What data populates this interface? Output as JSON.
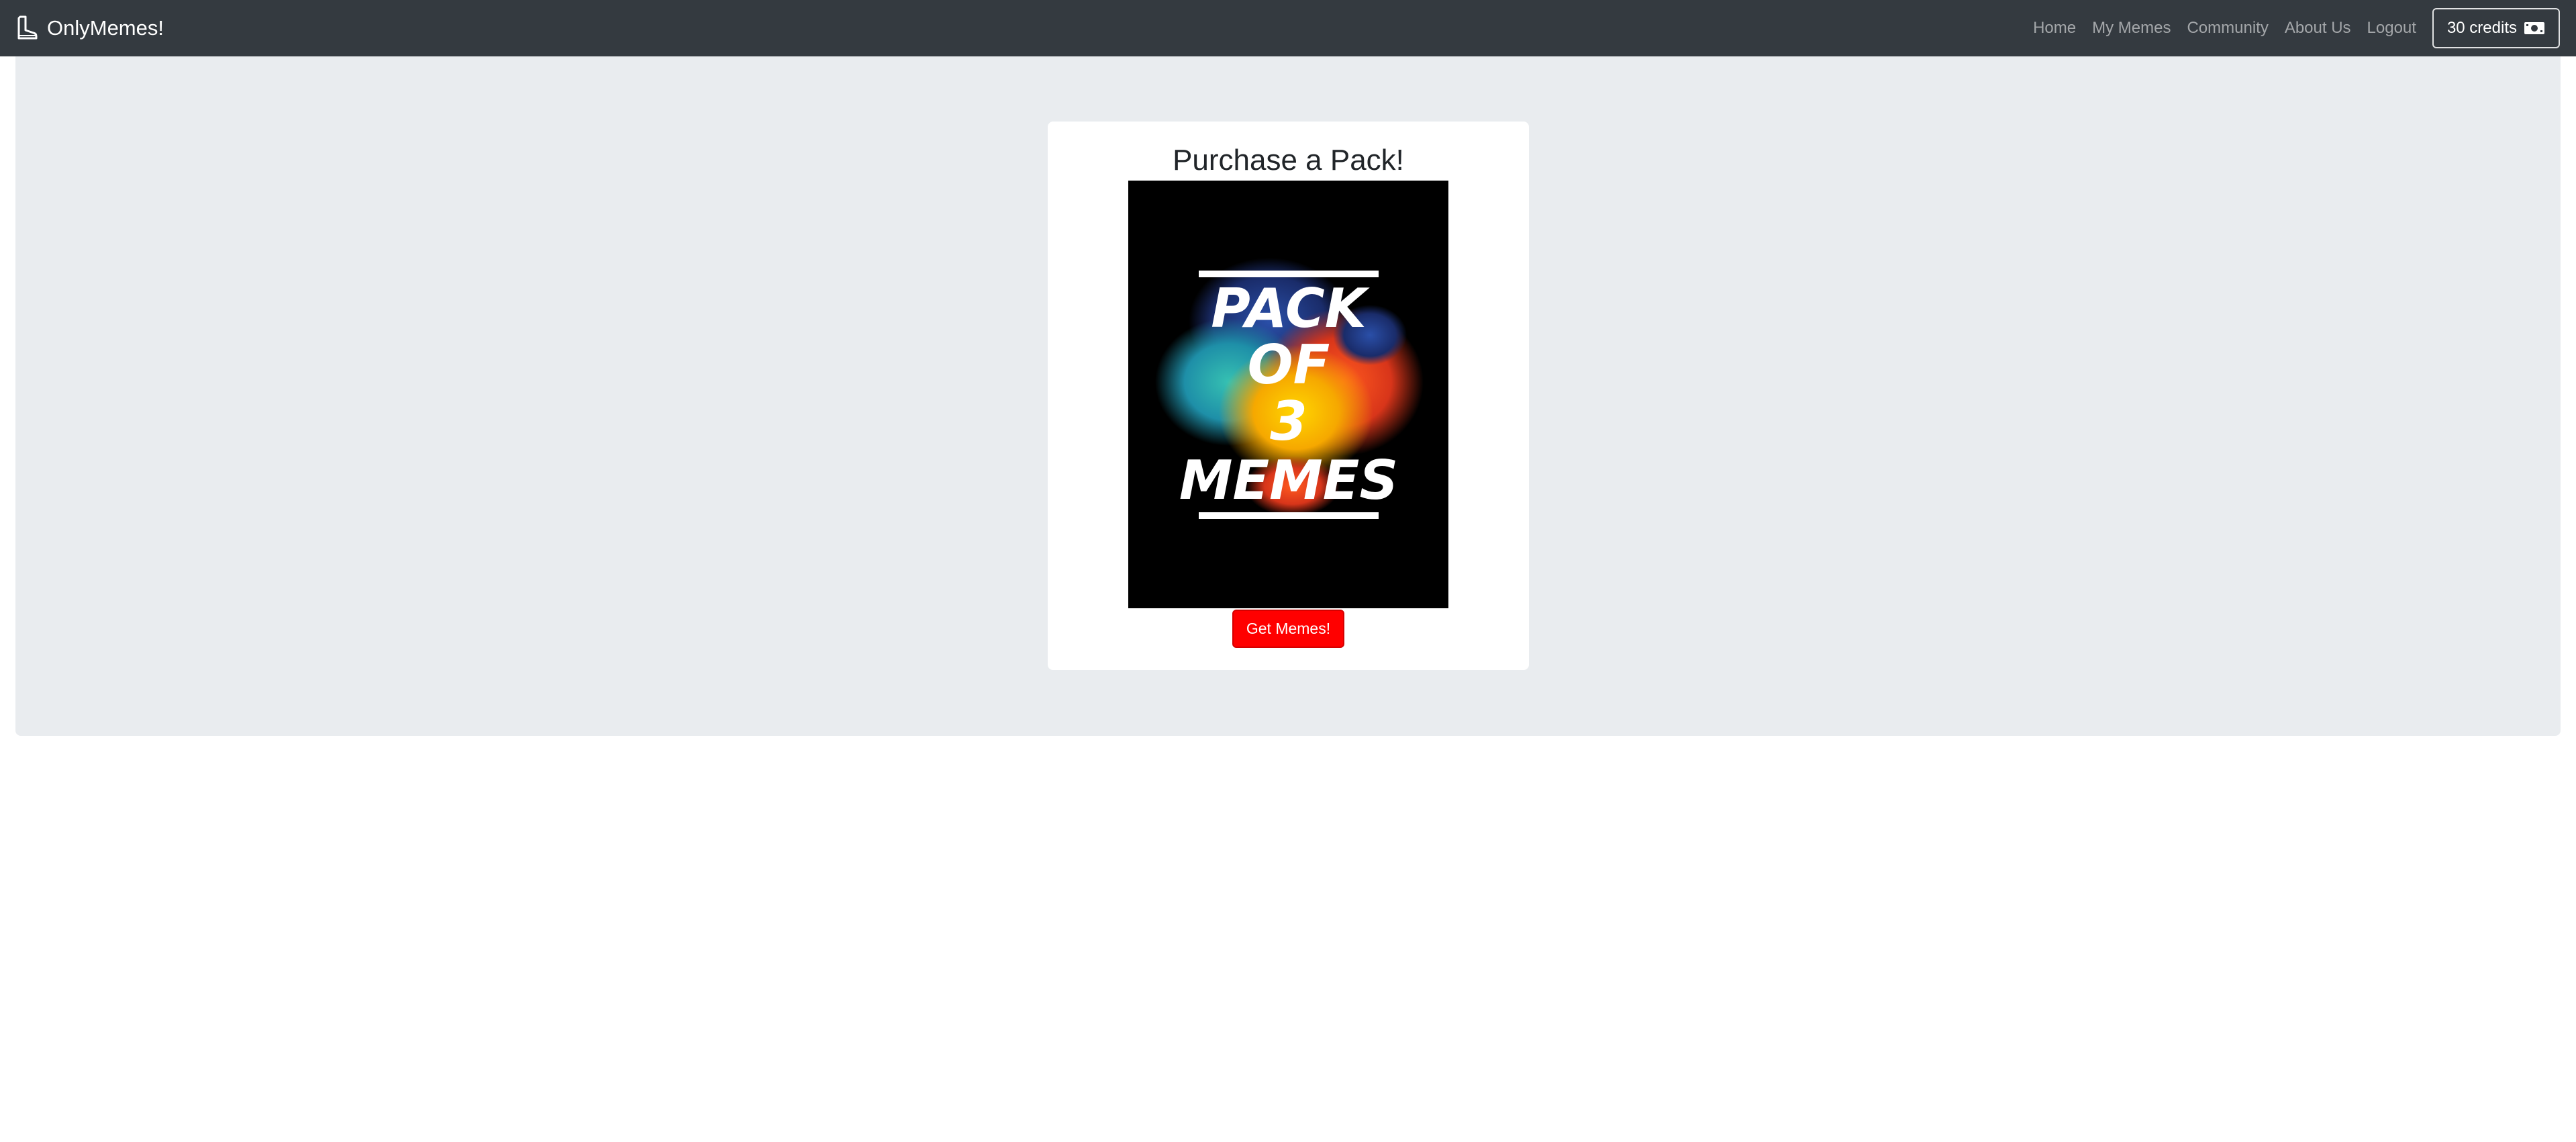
{
  "navbar": {
    "brand": "OnlyMemes!",
    "brand_icon": "boot-icon",
    "links": [
      "Home",
      "My Memes",
      "Community",
      "About Us",
      "Logout"
    ],
    "credits_label": "30 credits",
    "credits_icon": "cash-icon"
  },
  "main": {
    "title": "Purchase a Pack!",
    "image_alt_lines": [
      "PACK",
      "OF",
      "3",
      "MEMES"
    ],
    "button_label": "Get Memes!"
  },
  "colors": {
    "navbar_bg": "#343a40",
    "jumbotron_bg": "#e9ecef",
    "button_bg": "#ff0000"
  }
}
